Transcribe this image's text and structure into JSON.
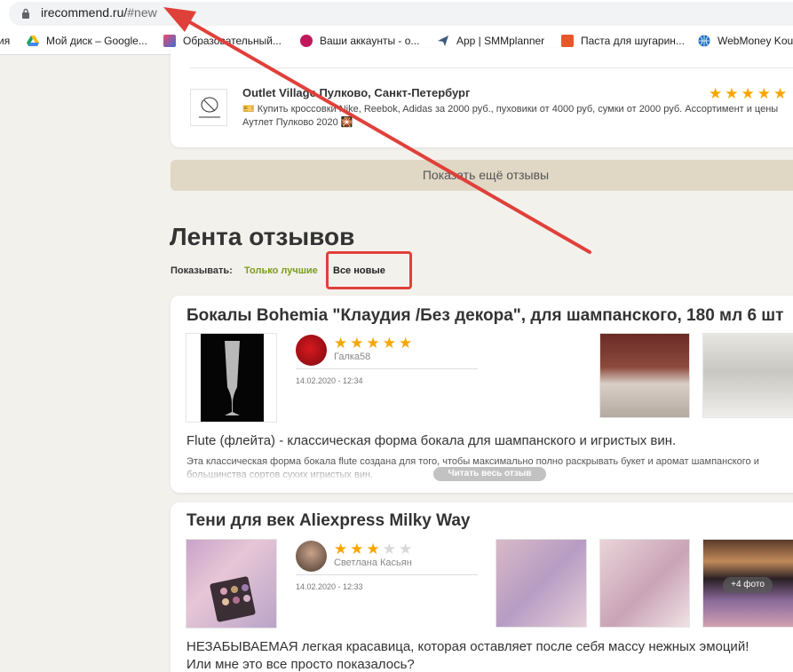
{
  "browser": {
    "url_host": "irecommend.ru/",
    "url_path": "#new",
    "bookmarks": [
      {
        "label": "ия",
        "icon": "none"
      },
      {
        "label": "Мой диск – Google...",
        "icon": "google-drive-icon"
      },
      {
        "label": "Образовательный...",
        "icon": "bookmark-favicon-icon"
      },
      {
        "label": "Ваши аккаунты - о...",
        "icon": "accounts-favicon-icon"
      },
      {
        "label": "App | SMMplanner",
        "icon": "paper-plane-icon"
      },
      {
        "label": "Паста для шугарин...",
        "icon": "bookmark-favicon-icon"
      },
      {
        "label": "WebMoney Kou",
        "icon": "globe-icon"
      }
    ]
  },
  "outlet": {
    "title": "Outlet Village Пулково, Санкт-Петербург",
    "description": "🎫 Купить кроссовки Nike, Reebok, Adidas за 2000 руб., пуховики от 4000 руб, сумки от 2000 руб. Ассортимент и цены Аутлет Пулково 2020 🎇",
    "rating": 5
  },
  "more_reviews_label": "Показать ещё отзывы",
  "feed": {
    "title": "Лента отзывов",
    "show_label": "Показывать:",
    "filter_best": "Только лучшие",
    "filter_new": "Все новые"
  },
  "reviews": [
    {
      "title": "Бокалы Bohemia \"Клаудия /Без декора\", для шампанского, 180 мл 6 шт",
      "author": "Галка58",
      "date": "14.02.2020 - 12:34",
      "rating": 5,
      "lead": "Flute (флейта) - классическая форма бокала для шампанского и игристых вин.",
      "body": "Эта классическая форма бокала flute создана для того, чтобы максимально полно раскрывать букет и аромат шампанского и большинства сортов сухих игристых вин.",
      "read_more": "Читать весь отзыв"
    },
    {
      "title": "Тени для век Aliexpress Milky Way",
      "author": "Светлана Касьян",
      "date": "14.02.2020 - 12:33",
      "rating": 3,
      "lead": "НЕЗАБЫВАЕМАЯ легкая красавица, которая оставляет после себя массу нежных эмоций! Или мне это все просто показалось?",
      "more_photos": "+4 фото"
    }
  ],
  "colors": {
    "accent_star": "#f7a600",
    "filter_active": "#7a9c1c",
    "annotation_red": "#e0403a",
    "button_beige": "#e0d7c5"
  }
}
